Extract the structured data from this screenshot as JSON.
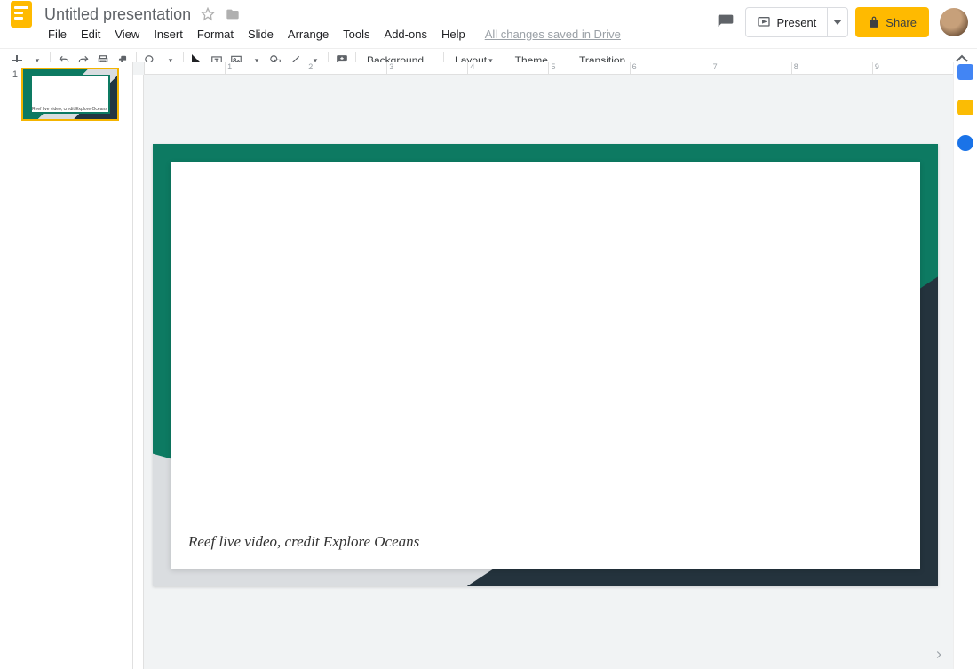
{
  "header": {
    "doc_title": "Untitled presentation",
    "present_label": "Present",
    "share_label": "Share"
  },
  "menus": {
    "file": "File",
    "edit": "Edit",
    "view": "View",
    "insert": "Insert",
    "format": "Format",
    "slide": "Slide",
    "arrange": "Arrange",
    "tools": "Tools",
    "addons": "Add-ons",
    "help": "Help",
    "saved_status": "All changes saved in Drive"
  },
  "toolbar": {
    "background": "Background...",
    "layout": "Layout",
    "theme": "Theme...",
    "transition": "Transition..."
  },
  "ruler": {
    "t1": "1",
    "t2": "2",
    "t3": "3",
    "t4": "4",
    "t5": "5",
    "t6": "6",
    "t7": "7",
    "t8": "8",
    "t9": "9"
  },
  "filmstrip": {
    "slide1_number": "1"
  },
  "slide": {
    "caption": "Reef live video, credit Explore Oceans"
  }
}
